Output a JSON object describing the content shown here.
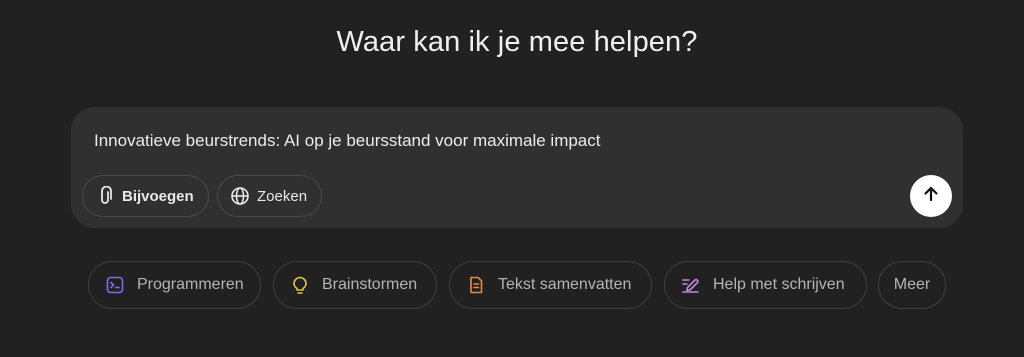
{
  "heading": "Waar kan ik je mee helpen?",
  "composer": {
    "text": "Innovatieve beurstrends: AI op je beursstand voor maximale impact",
    "attach_label": "Bijvoegen",
    "search_label": "Zoeken",
    "attach_icon": "paperclip-icon",
    "search_icon": "globe-icon",
    "send_icon": "arrow-up-icon"
  },
  "suggestions": [
    {
      "label": "Programmeren",
      "icon": "terminal-icon",
      "color": "#7c6cf0"
    },
    {
      "label": "Brainstormen",
      "icon": "lightbulb-icon",
      "color": "#e2c541"
    },
    {
      "label": "Tekst samenvatten",
      "icon": "document-icon",
      "color": "#e88a4c"
    },
    {
      "label": "Help met schrijven",
      "icon": "pen-icon",
      "color": "#c285e0"
    },
    {
      "label": "Meer"
    }
  ],
  "colors": {
    "background": "#212121",
    "composer": "#303030",
    "send_button": "#ffffff"
  }
}
